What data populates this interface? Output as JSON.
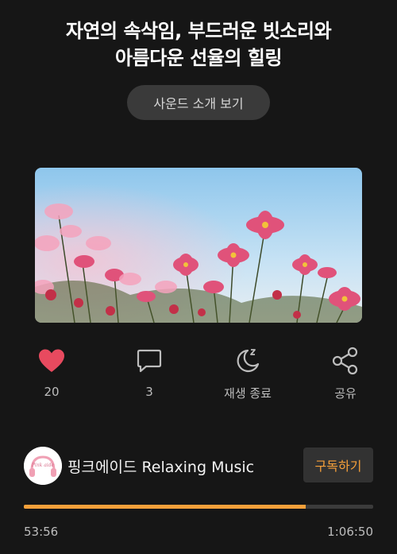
{
  "title": {
    "line1": "자연의 속삭임, 부드러운 빗소리와",
    "line2": "아름다운 선율의 힐링"
  },
  "intro_button": "사운드 소개 보기",
  "actions": {
    "like": {
      "label": "20",
      "icon": "heart-icon",
      "color": "#e84a5f"
    },
    "comment": {
      "label": "3",
      "icon": "comment-icon"
    },
    "sleep_timer": {
      "label": "재생 종료",
      "icon": "moon-icon"
    },
    "share": {
      "label": "공유",
      "icon": "share-icon"
    }
  },
  "channel": {
    "name": "핑크에이드 Relaxing Music",
    "subscribe_label": "구독하기",
    "avatar_text": "Pink aide"
  },
  "player": {
    "progress_fraction": 0.807,
    "elapsed": "53:56",
    "total": "1:06:50",
    "accent": "#f6a03a"
  }
}
